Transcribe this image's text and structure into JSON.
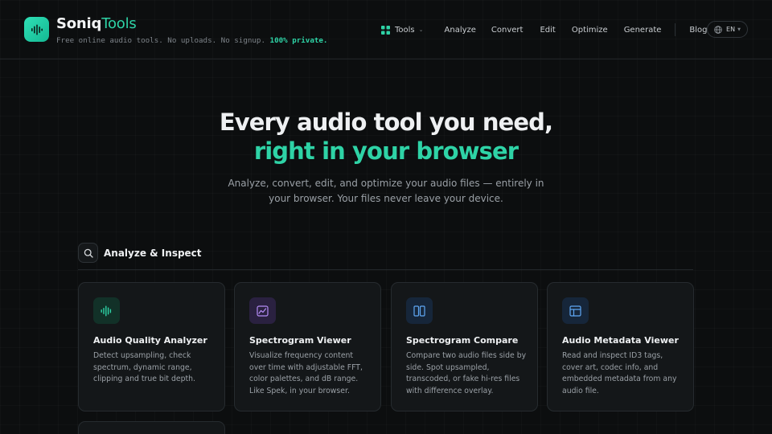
{
  "brand": {
    "name_part1": "Soniq",
    "name_part2": "Tools",
    "tagline_main": "Free online audio tools. No uploads. No signup.",
    "tagline_highlight": "100% private.",
    "logo_icon": "waveform-icon",
    "accent_color": "#2ed3a6"
  },
  "nav": {
    "tools_label": "Tools",
    "items": [
      "Analyze",
      "Convert",
      "Edit",
      "Optimize",
      "Generate"
    ],
    "blog_label": "Blog",
    "language_label": "EN"
  },
  "hero": {
    "title_line1": "Every audio tool you need,",
    "title_line2": "right in your browser",
    "subtitle": "Analyze, convert, edit, and optimize your audio files — entirely in your browser. Your files never leave your device."
  },
  "section": {
    "title": "Analyze & Inspect",
    "icon": "search-icon"
  },
  "cards": [
    {
      "title": "Audio Quality Analyzer",
      "description": "Detect upsampling, check spectrum, dynamic range, clipping and true bit depth.",
      "icon": "waveform-icon",
      "icon_color": "#2ed3a6"
    },
    {
      "title": "Spectrogram Viewer",
      "description": "Visualize frequency content over time with adjustable FFT, color palettes, and dB range. Like Spek, in your browser.",
      "icon": "chart-image-icon",
      "icon_color": "#b48cf5"
    },
    {
      "title": "Spectrogram Compare",
      "description": "Compare two audio files side by side. Spot upsampled, transcoded, or fake hi-res files with difference overlay.",
      "icon": "columns-icon",
      "icon_color": "#5fa8f5"
    },
    {
      "title": "Audio Metadata Viewer",
      "description": "Read and inspect ID3 tags, cover art, codec info, and embedded metadata from any audio file.",
      "icon": "layout-icon",
      "icon_color": "#5fa8f5"
    }
  ]
}
